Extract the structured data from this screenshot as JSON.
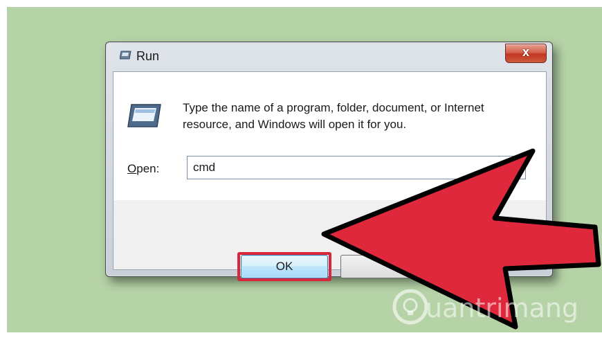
{
  "window": {
    "title": "Run",
    "close_label": "x"
  },
  "content": {
    "description": "Type the name of a program, folder, document, or Internet resource, and Windows will open it for you.",
    "open_label_first": "O",
    "open_label_rest": "pen:",
    "open_value": "cmd"
  },
  "buttons": {
    "ok_label": "OK"
  },
  "watermark": {
    "text": "uantrimang"
  },
  "icons": [
    "run-icon",
    "close-icon",
    "red-arrow-icon",
    "bulb-logo-icon"
  ],
  "colors": {
    "background": "#b6d3a7",
    "highlight": "#d8273a",
    "arrow": "#e0283c"
  }
}
